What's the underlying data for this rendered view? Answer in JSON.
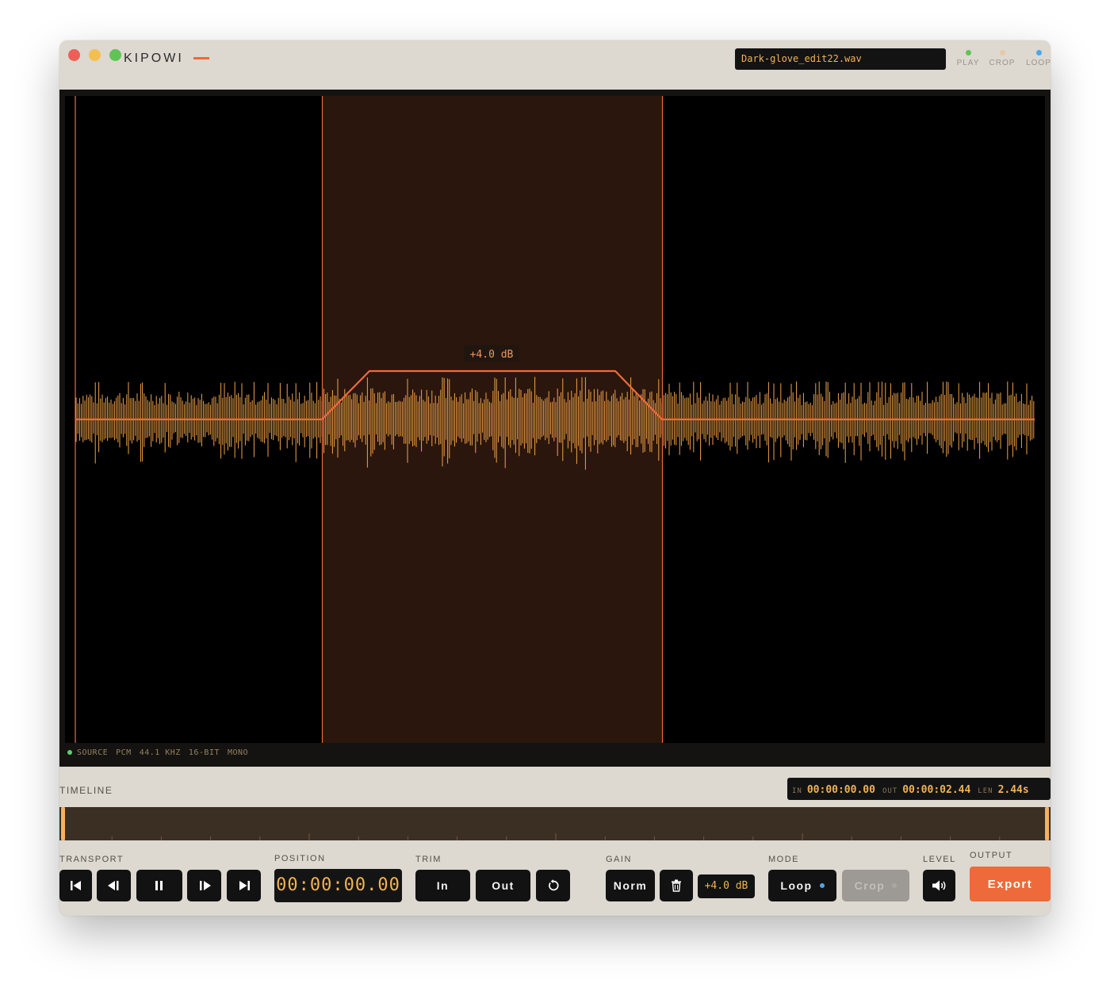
{
  "app": {
    "title": "KIPOWI",
    "filename": "Dark-glove_edit22.wav"
  },
  "indicators": [
    {
      "label": "PLAY",
      "color": "#5fc454"
    },
    {
      "label": "CROP",
      "color": "#e9c9a5"
    },
    {
      "label": "LOOP",
      "color": "#4da6e8"
    }
  ],
  "waveform": {
    "gain_label": "+4.0 dB",
    "colors": {
      "wave": "#f0a347",
      "accent": "#ee6a3a",
      "selection": "#2a160d"
    }
  },
  "status": {
    "items": [
      "SOURCE",
      "PCM",
      "44.1 KHZ",
      "16-BIT",
      "MONO"
    ]
  },
  "timeline": {
    "label": "TIMELINE",
    "in_key": "IN",
    "in_value": "00:00:00.00",
    "out_key": "OUT",
    "out_value": "00:00:02.44",
    "len_key": "LEN",
    "len_value": "2.44s"
  },
  "transport": {
    "label": "TRANSPORT",
    "buttons": [
      "skip-to-start",
      "step-back",
      "pause",
      "step-forward",
      "skip-to-end"
    ]
  },
  "position": {
    "label": "POSITION",
    "value": "00:00:00.00"
  },
  "trim": {
    "label": "TRIM",
    "in_label": "In",
    "out_label": "Out"
  },
  "gain": {
    "label": "GAIN",
    "norm_label": "Norm",
    "value": "+4.0 dB"
  },
  "mode": {
    "label": "MODE",
    "loop_label": "Loop",
    "crop_label": "Crop",
    "loop_dot_color": "#4da6e8"
  },
  "level": {
    "label": "LEVEL"
  },
  "output": {
    "label": "OUTPUT",
    "export_label": "Export"
  }
}
